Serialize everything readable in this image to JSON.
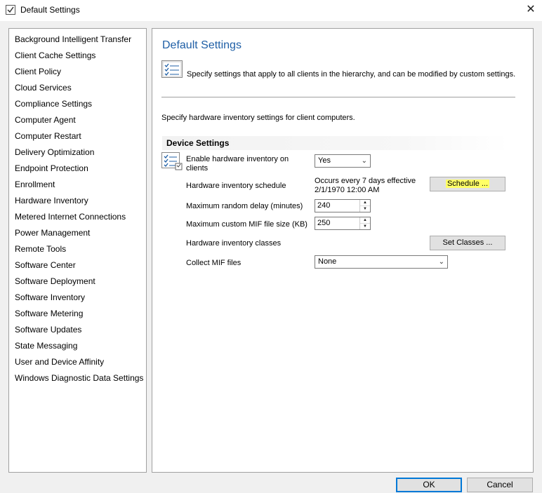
{
  "window": {
    "title": "Default Settings",
    "close_glyph": "✕"
  },
  "sidebar": {
    "selected_index": 9,
    "items": [
      {
        "label": "Background Intelligent Transfer"
      },
      {
        "label": "Client Cache Settings"
      },
      {
        "label": "Client Policy"
      },
      {
        "label": "Cloud Services"
      },
      {
        "label": "Compliance Settings"
      },
      {
        "label": "Computer Agent"
      },
      {
        "label": "Computer Restart"
      },
      {
        "label": "Delivery Optimization"
      },
      {
        "label": "Endpoint Protection"
      },
      {
        "label": "Enrollment"
      },
      {
        "label": "Hardware Inventory"
      },
      {
        "label": "Metered Internet Connections"
      },
      {
        "label": "Power Management"
      },
      {
        "label": "Remote Tools"
      },
      {
        "label": "Software Center"
      },
      {
        "label": "Software Deployment"
      },
      {
        "label": "Software Inventory"
      },
      {
        "label": "Software Metering"
      },
      {
        "label": "Software Updates"
      },
      {
        "label": "State Messaging"
      },
      {
        "label": "User and Device Affinity"
      },
      {
        "label": "Windows Diagnostic Data Settings"
      }
    ]
  },
  "main": {
    "heading": "Default Settings",
    "description": "Specify settings that apply to all clients in the hierarchy, and can be modified by custom settings.",
    "sub_description": "Specify hardware inventory settings for client computers.",
    "section_title": "Device Settings",
    "enable_label_line1": "Enable hardware inventory on",
    "enable_label_line2": "clients",
    "enable_value": "Yes",
    "schedule_label": "Hardware inventory schedule",
    "schedule_value_line1": "Occurs every 7 days effective",
    "schedule_value_line2": "2/1/1970 12:00 AM",
    "schedule_button": "Schedule ...",
    "delay_label": "Maximum random delay (minutes)",
    "delay_value": "240",
    "mif_size_label": "Maximum custom MIF file size (KB)",
    "mif_size_value": "250",
    "classes_label": "Hardware inventory classes",
    "classes_button": "Set Classes ...",
    "collect_mif_label": "Collect MIF files",
    "collect_mif_value": "None"
  },
  "footer": {
    "ok_label": "OK",
    "cancel_label": "Cancel"
  },
  "colors": {
    "heading": "#1f5fa6",
    "selection": "#99c9ef",
    "highlight_green": "#b4e85a",
    "highlight_yellow": "#ffff66",
    "default_button_border": "#0078d7"
  }
}
